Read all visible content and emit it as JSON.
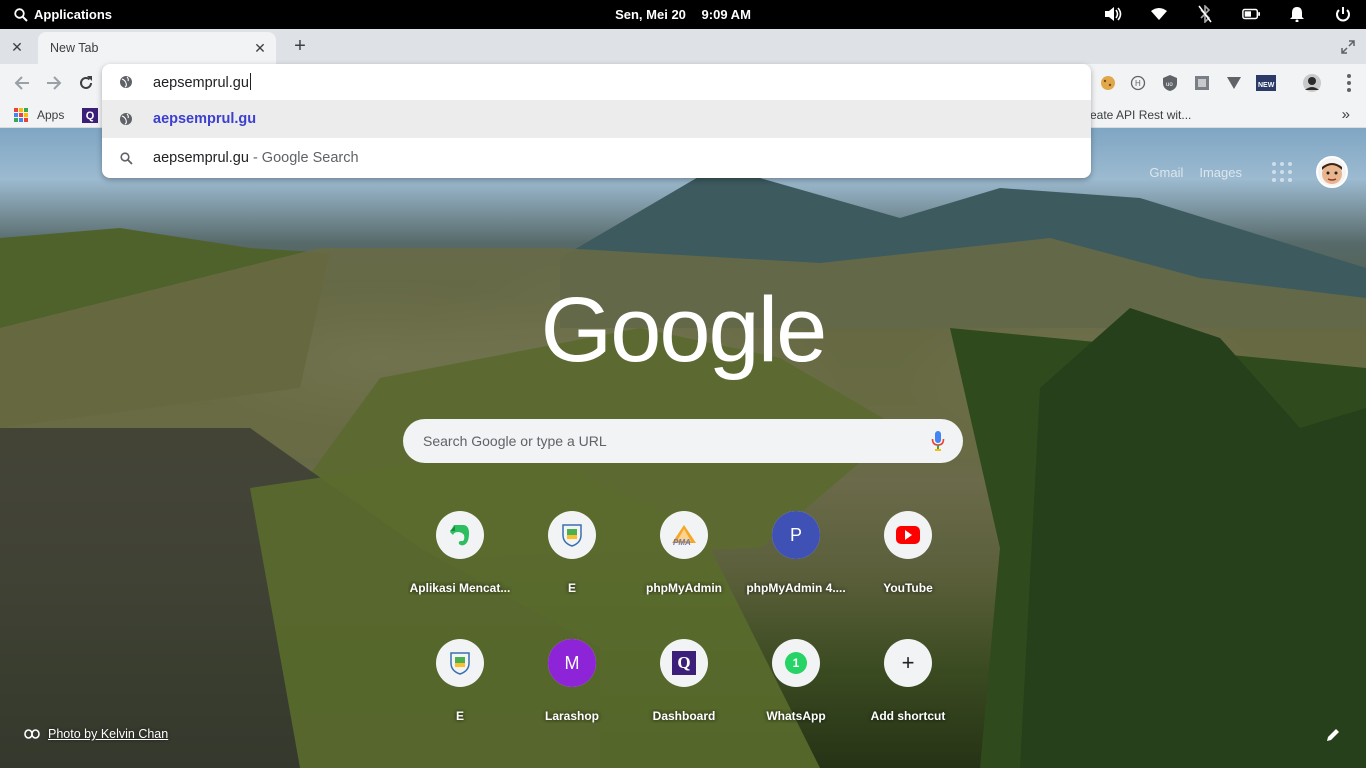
{
  "system_panel": {
    "applications_label": "Applications",
    "date": "Sen, Mei 20",
    "time": "9:09 AM",
    "tray_icons": [
      "volume-icon",
      "wifi-icon",
      "bluetooth-off-icon",
      "battery-icon",
      "notifications-icon",
      "power-icon"
    ]
  },
  "tabs": [
    {
      "title": "New Tab",
      "active": true
    }
  ],
  "toolbar": {
    "extensions": [
      "cookie-icon",
      "h-icon",
      "ublock-icon",
      "puzzle-icon",
      "v-icon",
      "new-badge-icon",
      "profile-icon"
    ]
  },
  "omnibox": {
    "input_value": "aepsemprul.gu",
    "suggestions": [
      {
        "icon": "globe-icon",
        "text": "aepsemprul.gu",
        "sub": ""
      },
      {
        "icon": "search-icon",
        "text": "aepsemprul.gu",
        "sub": " - Google Search"
      }
    ]
  },
  "bookmarks": {
    "apps_label": "Apps",
    "visible_right": "reate API Rest wit..."
  },
  "ntp": {
    "links": {
      "gmail": "Gmail",
      "images": "Images"
    },
    "logo_text": "Google",
    "search_placeholder": "Search Google or type a URL",
    "shortcuts": [
      {
        "label": "Aplikasi Mencat...",
        "icon": "evernote-icon",
        "letter": ""
      },
      {
        "label": "E",
        "icon": "crest-icon",
        "letter": ""
      },
      {
        "label": "phpMyAdmin",
        "icon": "pma-icon",
        "letter": "PMA"
      },
      {
        "label": "phpMyAdmin 4....",
        "icon": "letter-icon",
        "letter": "P"
      },
      {
        "label": "YouTube",
        "icon": "youtube-icon",
        "letter": ""
      },
      {
        "label": "E",
        "icon": "crest-icon",
        "letter": ""
      },
      {
        "label": "Larashop",
        "icon": "letter-icon",
        "letter": "M"
      },
      {
        "label": "Dashboard",
        "icon": "q-icon",
        "letter": "Q"
      },
      {
        "label": "WhatsApp",
        "icon": "whatsapp-icon",
        "letter": "1"
      },
      {
        "label": "Add shortcut",
        "icon": "plus-icon",
        "letter": "+"
      }
    ],
    "photo_credit": "Photo by Kelvin Chan"
  },
  "colors": {
    "link_blue": "#3c3fcf",
    "chrome_gray": "#f1f3f4",
    "youtube_red": "#ff0000",
    "letter_p_blue": "#3f51b5",
    "letter_m_purple": "#8e24d8"
  }
}
